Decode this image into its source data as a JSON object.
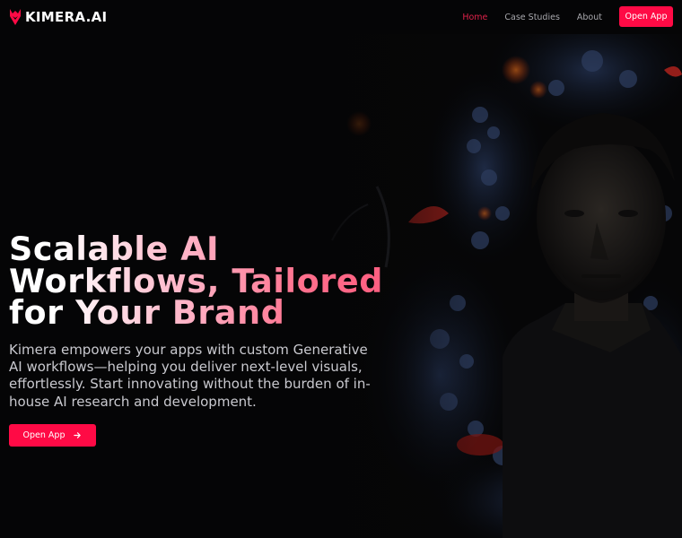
{
  "brand": {
    "name": "KIMERA.AI",
    "accent": "#ff0a45",
    "logo_icon": "kimera-mark-icon"
  },
  "nav": {
    "links": [
      {
        "label": "Home",
        "active": true
      },
      {
        "label": "Case Studies",
        "active": false
      },
      {
        "label": "About",
        "active": false
      }
    ],
    "cta_label": "Open App"
  },
  "hero": {
    "title_line1": "Scalable AI",
    "title_line2": "Workflows, Tailored",
    "title_line3": "for Your Brand",
    "subtitle": "Kimera empowers your apps with custom Generative AI workflows—helping you deliver next-level visuals, effortlessly. Start innovating without the burden of in-house AI research and development.",
    "cta_label": "Open App",
    "cta_icon": "arrow-right-icon"
  }
}
